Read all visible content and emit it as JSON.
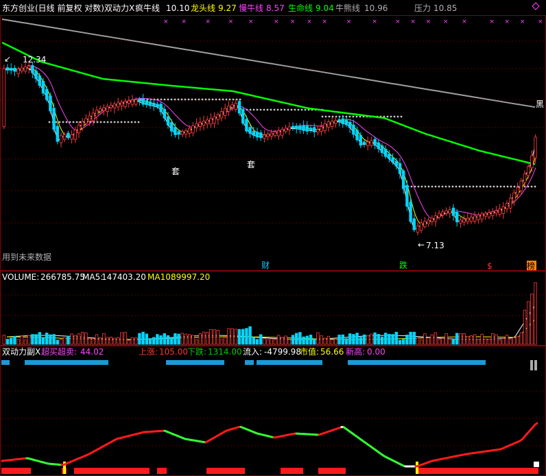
{
  "header": {
    "title": "东方创业(日线 前复权 对数)",
    "indicator": "双动力X",
    "items": [
      {
        "label": "疯牛线",
        "value": "10.10",
        "color": "#ffffff"
      },
      {
        "label": "龙头线",
        "value": "9.27",
        "color": "#ffff00"
      },
      {
        "label": "慢牛线",
        "value": "8.57",
        "color": "#ff44ff"
      },
      {
        "label": "生命线",
        "value": "9.04",
        "color": "#00ff00"
      },
      {
        "label": "牛熊线",
        "value": "10.96",
        "color": "#b0b0b0"
      },
      {
        "label": "压力",
        "value": "10.85",
        "color": "#b0b0b0"
      }
    ]
  },
  "main_annotations": {
    "high_label": "12.34",
    "low_label": "7.13",
    "tao1": "套",
    "tao2": "套",
    "hei": "黑",
    "future": "用到未来数据",
    "cai": "财",
    "die": "跌",
    "s": "$",
    "bang": "榜"
  },
  "volume": {
    "label": "VOLUME:",
    "value": "266785.75",
    "ma5_label": "MA5:",
    "ma5": "147403.20",
    "ma10_label": "MA10:",
    "ma10": "89997.20"
  },
  "sub": {
    "name": "双动力副X",
    "items": [
      {
        "label": "超买超卖:",
        "value": "44.02",
        "color": "#ff44ff"
      },
      {
        "label": "上涨:",
        "value": "105.00",
        "color": "#ff3333"
      },
      {
        "label": "下跌:",
        "value": "1314.00",
        "color": "#00cc00"
      },
      {
        "label": "流入:",
        "value": "-4799.98",
        "color": "#ffffff"
      },
      {
        "label": "市值:",
        "value": "56.66",
        "color": "#ffff00"
      },
      {
        "label": "新高:",
        "value": "0.00",
        "color": "#ff44ff"
      }
    ]
  },
  "chart_data": {
    "type": "candlestick",
    "y_scale": "log",
    "ylim": [
      6.8,
      13.6
    ],
    "grid": true,
    "colors": {
      "up": "#ff3b3b",
      "down": "#00d6ff",
      "crazy_bull": "#ffffff",
      "leader": "#ffff00",
      "slow_bull": "#ff44ff",
      "life": "#00ff00",
      "bull_bear": "#a0a0a0",
      "pressure": "#b0b0b0"
    }
  }
}
